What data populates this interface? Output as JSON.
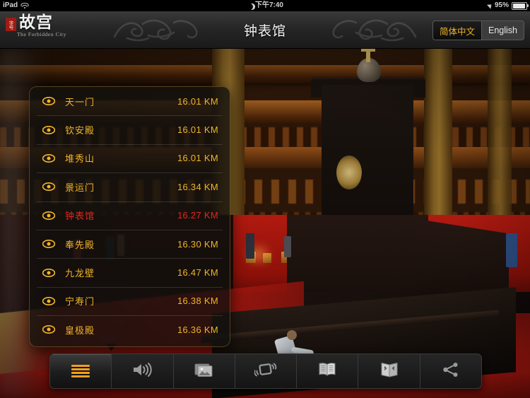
{
  "status_bar": {
    "device": "iPad",
    "wifi_icon": "wifi-icon",
    "dnd_icon": "moon-icon",
    "time": "下午7:40",
    "location_icon": "location-arrow-icon",
    "battery_percent": "95%",
    "battery_icon": "battery-icon"
  },
  "header": {
    "logo": {
      "seal_text": "字号",
      "cn": "故宫",
      "en": "The Forbidden City"
    },
    "title": "钟表馆",
    "language": {
      "options": [
        "简体中文",
        "English"
      ],
      "selected": "简体中文"
    },
    "ornament_icon": "dragon-motif-icon"
  },
  "poi_panel": {
    "visibility_icon": "eye-icon",
    "selected_name": "钟表馆",
    "items": [
      {
        "name": "天一门",
        "distance": "16.01 KM",
        "selected": false
      },
      {
        "name": "钦安殿",
        "distance": "16.01 KM",
        "selected": false
      },
      {
        "name": "堆秀山",
        "distance": "16.01 KM",
        "selected": false
      },
      {
        "name": "景运门",
        "distance": "16.34 KM",
        "selected": false
      },
      {
        "name": "钟表馆",
        "distance": "16.27 KM",
        "selected": true
      },
      {
        "name": "奉先殿",
        "distance": "16.30 KM",
        "selected": false
      },
      {
        "name": "九龙壁",
        "distance": "16.47 KM",
        "selected": false
      },
      {
        "name": "宁寿门",
        "distance": "16.38 KM",
        "selected": false
      },
      {
        "name": "皇极殿",
        "distance": "16.36 KM",
        "selected": false
      }
    ]
  },
  "toolbar": {
    "items": [
      {
        "icon": "list-icon",
        "label": "列表",
        "active": true
      },
      {
        "icon": "speaker-icon",
        "label": "语音",
        "active": false
      },
      {
        "icon": "photos-icon",
        "label": "图片",
        "active": false
      },
      {
        "icon": "shake-icon",
        "label": "摇一摇",
        "active": false
      },
      {
        "icon": "book-icon",
        "label": "图文",
        "active": false
      },
      {
        "icon": "map-icon",
        "label": "地图",
        "active": false
      },
      {
        "icon": "share-icon",
        "label": "分享",
        "active": false
      }
    ]
  },
  "colors": {
    "accent_gold": "#f0b429",
    "selected_red": "#e8231d",
    "bar_dark": "#262626",
    "wall_red": "#b11a10"
  },
  "background_photo": {
    "description": "钟表馆展厅内景"
  }
}
